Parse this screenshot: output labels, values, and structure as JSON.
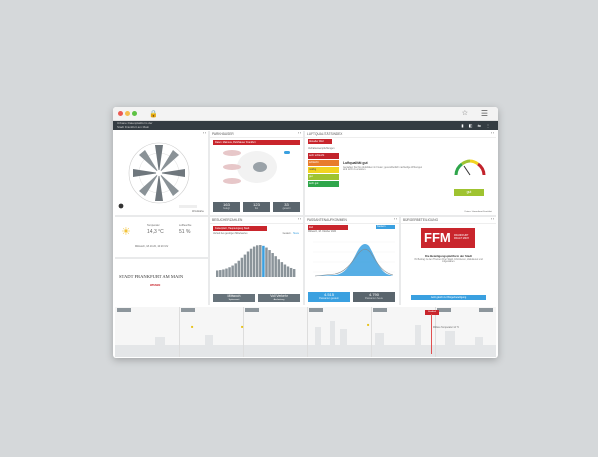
{
  "browser": {
    "lock": "🔒",
    "star": "☆",
    "menu": "☰"
  },
  "app": {
    "title": "Urbane Datenplattform der\nStadt Frankfurt am Main",
    "icons": "▮ ◧ ⇆ ⋮"
  },
  "wind": {
    "ctl": "‹ ›",
    "legend": "Windstärke"
  },
  "parking": {
    "title": "PARKHÄUSER",
    "ctl": "‹ ›",
    "banner": "Daten: Mainova, Parkhäuser Frankfurt",
    "rows": [
      "Parkhaus",
      "Tiefgarage",
      "Parkplatz"
    ],
    "stats": [
      {
        "v": "163",
        "l": "belegt"
      },
      {
        "v": "123",
        "l": "frei"
      },
      {
        "v": "33",
        "l": "gesamt"
      }
    ]
  },
  "air": {
    "title": "LUFTQUALITÄTSINDEX",
    "ctl": "‹ ›",
    "tag": "Aktueller Wert",
    "subtitle": "Verhaltensempfehlungen",
    "levels": [
      "sehr schlecht",
      "schlecht",
      "mäßig",
      "gut",
      "sehr gut"
    ],
    "heading": "Luftqualität gut",
    "desc": "Genießen Sie Ihre Aktivitäten im Freien; gesundheitlich nachteilige Wirkungen sind nicht zu erwarten.",
    "status": "gut",
    "source": "Daten: Umweltamt Frankfurt"
  },
  "weather": {
    "temp_label": "Temperatur",
    "temp": "14,3 °C",
    "hum_label": "Luftfeuchte",
    "hum": "51 %",
    "date": "Mittwoch, 18.10.20, 10:20 Uhr"
  },
  "city": {
    "name": "STADT FRANKFURT AM MAIN",
    "sub": "WISSEN"
  },
  "visitors": {
    "title": "BESUCHERZAHLEN",
    "ctl": "‹ ›",
    "banner": "Kaiserplatz, Haupteingang Stadt",
    "subtitle": "Verlauf des gestrigen Mittelwertes",
    "legend": [
      "Gestern",
      "Heute"
    ],
    "stats": [
      {
        "v": "Mittwoch",
        "l": "Spitzenzeit"
      },
      {
        "v": "Voll Verkehr",
        "l": "Auslastung"
      }
    ]
  },
  "pedestrians": {
    "title": "PASSANTENAUFKOMMEN",
    "ctl": "‹ ›",
    "tag": "Zeil",
    "select": "Gestern",
    "subtitle": "Mittwoch, 18. Oktober 2020",
    "stats": [
      {
        "v": "4.515",
        "l": "Passanten gestern"
      },
      {
        "v": "4.790",
        "l": "Passanten heute"
      }
    ]
  },
  "citizen": {
    "title": "BÜRGERBETEILIGUNG",
    "ctl": "‹ ›",
    "logo": "FFM",
    "logo_sub": "FRANKFURT FRAGT MICH",
    "heading": "Die Beteiligungsplattform der Stadt",
    "desc": "Ihr Beitrag zu den Themen Ihrer Stadt. Informieren, diskutieren und mitgestalten.",
    "button": "Jetzt gleich zur Bürgerbeteiligung"
  },
  "timeline": {
    "labels": [
      "",
      "",
      "",
      "",
      "",
      "",
      ""
    ],
    "marker": "Stadtteil",
    "note": "Mittlere Temperatur 14 °C"
  }
}
